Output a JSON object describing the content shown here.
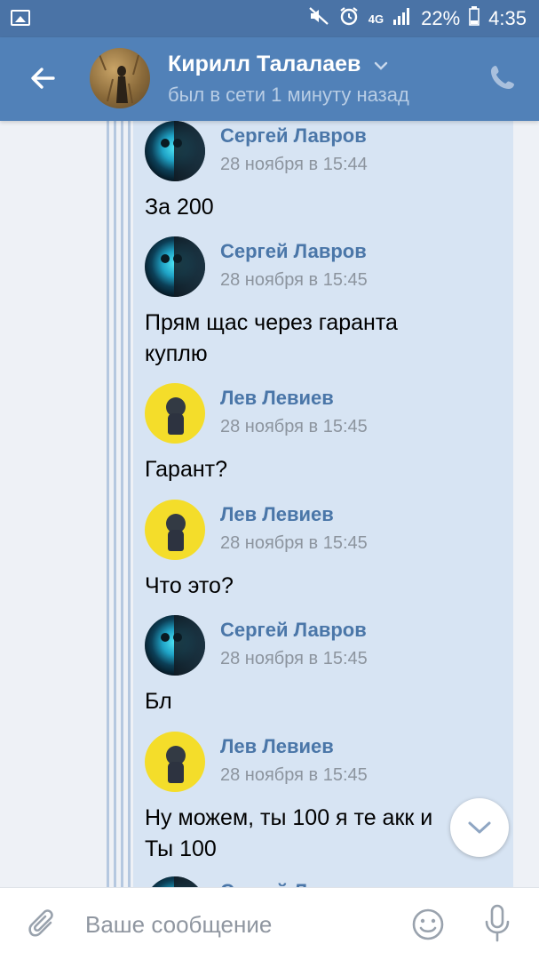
{
  "status_bar": {
    "network": "4G",
    "battery": "22%",
    "time": "4:35"
  },
  "header": {
    "contact_name": "Кирилл Талалаев",
    "contact_status": "был в сети 1 минуту назад"
  },
  "messages": [
    {
      "author": "Сергей Лавров",
      "time": "28 ноября в 15:44",
      "text_lines": [
        "За 200"
      ],
      "avatar": "skull-avatar"
    },
    {
      "author": "Сергей Лавров",
      "time": "28 ноября в 15:45",
      "text_lines": [
        "Прям щас через гаранта",
        "куплю"
      ],
      "avatar": "skull-avatar"
    },
    {
      "author": "Лев Левиев",
      "time": "28 ноября в 15:45",
      "text_lines": [
        "Гарант?"
      ],
      "avatar": "yellow-avatar"
    },
    {
      "author": "Лев Левиев",
      "time": "28 ноября в 15:45",
      "text_lines": [
        "Что это?"
      ],
      "avatar": "yellow-avatar"
    },
    {
      "author": "Сергей Лавров",
      "time": "28 ноября в 15:45",
      "text_lines": [
        "Бл"
      ],
      "avatar": "skull-avatar"
    },
    {
      "author": "Лев Левиев",
      "time": "28 ноября в 15:45",
      "text_lines": [
        "Ну можем, ты 100 я те акк и",
        "Ты 100"
      ],
      "avatar": "yellow-avatar"
    },
    {
      "author": "Сергей Лавров",
      "time": "",
      "text_lines": [],
      "avatar": "skull-avatar"
    }
  ],
  "input": {
    "placeholder": "Ваше сообщение"
  },
  "colors": {
    "header_bg": "#5181b8",
    "status_bg": "#4a73a6",
    "bubble_bg": "#d7e4f3",
    "author_link": "#4a76a8",
    "time_text": "#8c949e"
  },
  "icons": {
    "back": "arrow-left-icon",
    "dropdown": "chevron-down-icon",
    "call": "phone-icon",
    "scroll_down": "chevron-down-icon",
    "attach": "paperclip-icon",
    "emoji": "smile-icon",
    "voice": "mic-icon"
  }
}
